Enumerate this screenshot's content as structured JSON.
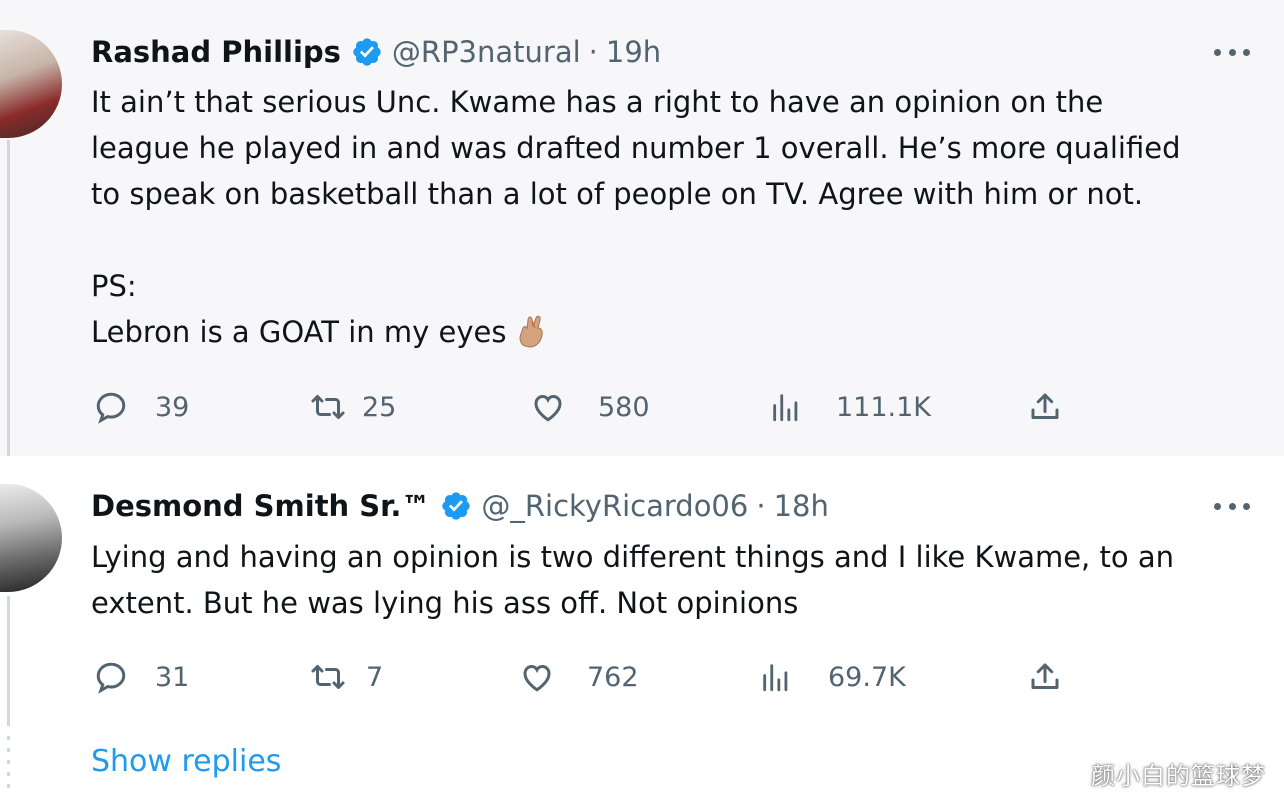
{
  "tweets": [
    {
      "author": "Rashad Phillips",
      "handle": "@RP3natural",
      "separator": "·",
      "time": "19h",
      "lines": [
        "It ain’t that serious Unc. Kwame has a right to have an opinion on the",
        "league he played in and was drafted number 1 overall. He’s more qualified",
        "to speak on basketball than a lot of people on TV. Agree with him or not.",
        "",
        "PS:",
        "Lebron is a GOAT in my eyes"
      ],
      "emoji_icon": "crossed-fingers-emoji",
      "replies": "39",
      "retweets": "25",
      "likes": "580",
      "views": "111.1K"
    },
    {
      "author": "Desmond Smith Sr.™",
      "handle": "@_RickyRicardo06",
      "separator": "·",
      "time": "18h",
      "lines": [
        "Lying and having an opinion is two different things and I like Kwame, to an",
        "extent. But he was lying his ass off. Not opinions"
      ],
      "replies": "31",
      "retweets": "7",
      "likes": "762",
      "views": "69.7K"
    }
  ],
  "show_replies_label": "Show replies",
  "watermark": "颜小白的篮球梦",
  "colors": {
    "verified": "#1d9bf0",
    "link": "#1d9bf0",
    "muted": "#536471",
    "text": "#0f1419"
  }
}
